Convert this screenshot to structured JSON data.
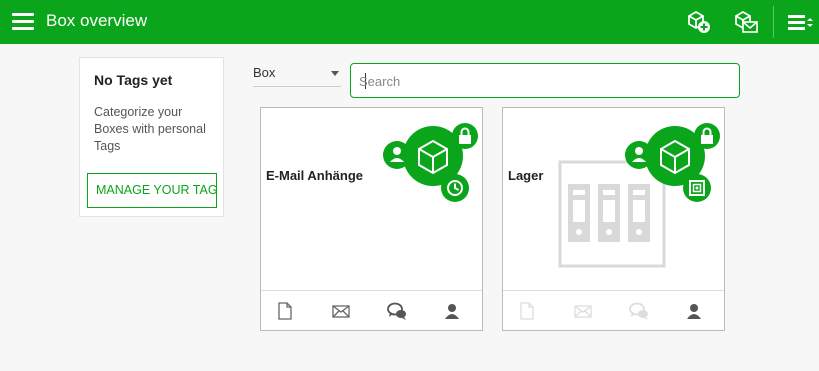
{
  "header": {
    "title": "Box overview",
    "actions": [
      {
        "name": "add-box-icon"
      },
      {
        "name": "mail-box-icon"
      },
      {
        "name": "list-menu-icon"
      }
    ]
  },
  "sidebar": {
    "heading": "No Tags yet",
    "description": "Categorize your Boxes with personal Tags",
    "manage_label": "MANAGE YOUR TAGS"
  },
  "filter": {
    "type_value": "Box",
    "search_placeholder": "Search",
    "search_value": ""
  },
  "boxes": [
    {
      "name": "E-Mail Anhänge",
      "badges": [
        "lock-icon",
        "user-icon",
        "clock-icon"
      ]
    },
    {
      "name": "Lager",
      "badges": [
        "lock-icon",
        "user-icon",
        "safe-icon"
      ]
    }
  ],
  "colors": {
    "accent": "#0aa51b",
    "muted": "#d9d9d9"
  }
}
